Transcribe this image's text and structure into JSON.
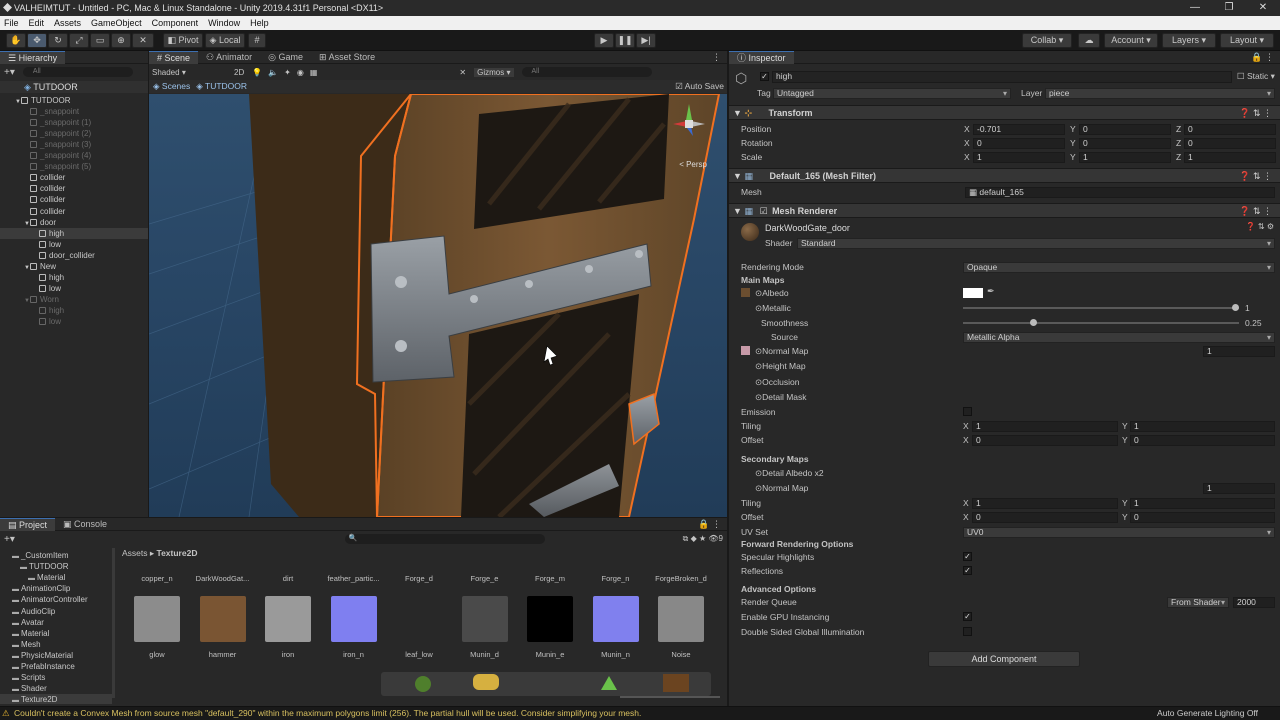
{
  "window": {
    "title": "VALHEIMTUT - Untitled - PC, Mac & Linux Standalone - Unity 2019.4.31f1 Personal <DX11>",
    "controls": [
      "—",
      "❐",
      "✕"
    ]
  },
  "menu": [
    "File",
    "Edit",
    "Assets",
    "GameObject",
    "Component",
    "Window",
    "Help"
  ],
  "toolbar": {
    "pivot": "Pivot",
    "local": "Local",
    "collab": "Collab",
    "account": "Account",
    "layers": "Layers",
    "layout": "Layout"
  },
  "hierarchy": {
    "tab": "Hierarchy",
    "search": "All",
    "scene": "TUTDOOR",
    "items": [
      {
        "label": "TUTDOOR",
        "depth": 1,
        "dim": false,
        "arrow": "▼"
      },
      {
        "label": "_snappoint",
        "depth": 2,
        "dim": true,
        "arrow": ""
      },
      {
        "label": "_snappoint (1)",
        "depth": 2,
        "dim": true,
        "arrow": ""
      },
      {
        "label": "_snappoint (2)",
        "depth": 2,
        "dim": true,
        "arrow": ""
      },
      {
        "label": "_snappoint (3)",
        "depth": 2,
        "dim": true,
        "arrow": ""
      },
      {
        "label": "_snappoint (4)",
        "depth": 2,
        "dim": true,
        "arrow": ""
      },
      {
        "label": "_snappoint (5)",
        "depth": 2,
        "dim": true,
        "arrow": ""
      },
      {
        "label": "collider",
        "depth": 2,
        "dim": false,
        "arrow": ""
      },
      {
        "label": "collider",
        "depth": 2,
        "dim": false,
        "arrow": ""
      },
      {
        "label": "collider",
        "depth": 2,
        "dim": false,
        "arrow": ""
      },
      {
        "label": "collider",
        "depth": 2,
        "dim": false,
        "arrow": ""
      },
      {
        "label": "door",
        "depth": 2,
        "dim": false,
        "arrow": "▼"
      },
      {
        "label": "high",
        "depth": 3,
        "dim": false,
        "arrow": "",
        "selected": true
      },
      {
        "label": "low",
        "depth": 3,
        "dim": false,
        "arrow": ""
      },
      {
        "label": "door_collider",
        "depth": 3,
        "dim": false,
        "arrow": ""
      },
      {
        "label": "New",
        "depth": 2,
        "dim": false,
        "arrow": "▼"
      },
      {
        "label": "high",
        "depth": 3,
        "dim": false,
        "arrow": ""
      },
      {
        "label": "low",
        "depth": 3,
        "dim": false,
        "arrow": ""
      },
      {
        "label": "Worn",
        "depth": 2,
        "dim": true,
        "arrow": "▼"
      },
      {
        "label": "high",
        "depth": 3,
        "dim": true,
        "arrow": ""
      },
      {
        "label": "low",
        "depth": 3,
        "dim": true,
        "arrow": ""
      }
    ]
  },
  "scene": {
    "tabs": [
      "Scene",
      "Animator",
      "Game",
      "Asset Store"
    ],
    "shading": "Shaded",
    "mode2d": "2D",
    "gizmos": "Gizmos",
    "search": "All",
    "breadcrumb": [
      "Scenes",
      "TUTDOOR"
    ],
    "autosave": "Auto Save",
    "persp": "< Persp"
  },
  "inspector": {
    "tab": "Inspector",
    "object_name": "high",
    "static": "Static",
    "tag_label": "Tag",
    "tag": "Untagged",
    "layer_label": "Layer",
    "layer": "piece",
    "transform": {
      "title": "Transform",
      "position_label": "Position",
      "position": [
        "-0.701",
        "0",
        "0"
      ],
      "rotation_label": "Rotation",
      "rotation": [
        "0",
        "0",
        "0"
      ],
      "scale_label": "Scale",
      "scale": [
        "1",
        "1",
        "1"
      ]
    },
    "mesh_filter": {
      "title": "Default_165 (Mesh Filter)",
      "mesh_label": "Mesh",
      "mesh": "default_165"
    },
    "mesh_renderer": {
      "title": "Mesh Renderer"
    },
    "material": {
      "name": "DarkWoodGate_door",
      "shader_label": "Shader",
      "shader": "Standard",
      "rendering_mode_label": "Rendering Mode",
      "rendering_mode": "Opaque",
      "main_maps": "Main Maps",
      "albedo": "Albedo",
      "metallic": "Metallic",
      "metallic_value": 1,
      "metallic_text": "1",
      "smoothness": "Smoothness",
      "smoothness_value": 0.25,
      "smoothness_text": "0.25",
      "source_label": "Source",
      "source": "Metallic Alpha",
      "normal_map": "Normal Map",
      "normal_value": "1",
      "height_map": "Height Map",
      "occlusion": "Occlusion",
      "detail_mask": "Detail Mask",
      "emission": "Emission",
      "tiling_label": "Tiling",
      "tiling": [
        "1",
        "1"
      ],
      "offset_label": "Offset",
      "offset": [
        "0",
        "0"
      ],
      "secondary_maps": "Secondary Maps",
      "detail_albedo": "Detail Albedo x2",
      "normal_map2": "Normal Map",
      "normal_value2": "1",
      "tiling2": [
        "1",
        "1"
      ],
      "offset2": [
        "0",
        "0"
      ],
      "uvset_label": "UV Set",
      "uvset": "UV0",
      "forward_options": "Forward Rendering Options",
      "specular_highlights": "Specular Highlights",
      "reflections": "Reflections",
      "advanced_options": "Advanced Options",
      "render_queue_label": "Render Queue",
      "render_queue_mode": "From Shader",
      "render_queue": "2000",
      "gpu_instancing": "Enable GPU Instancing",
      "double_sided_gi": "Double Sided Global Illumination"
    },
    "add_component": "Add Component"
  },
  "project": {
    "tabs": [
      "Project",
      "Console"
    ],
    "breadcrumb": [
      "Assets",
      "Texture2D"
    ],
    "count": "9",
    "tree": [
      {
        "label": "_CustomItem",
        "depth": 1
      },
      {
        "label": "TUTDOOR",
        "depth": 2
      },
      {
        "label": "Material",
        "depth": 3
      },
      {
        "label": "AnimationClip",
        "depth": 1
      },
      {
        "label": "AnimatorController",
        "depth": 1
      },
      {
        "label": "AudioClip",
        "depth": 1
      },
      {
        "label": "Avatar",
        "depth": 1
      },
      {
        "label": "Material",
        "depth": 1
      },
      {
        "label": "Mesh",
        "depth": 1
      },
      {
        "label": "PhysicMaterial",
        "depth": 1
      },
      {
        "label": "PrefabInstance",
        "depth": 1
      },
      {
        "label": "Scripts",
        "depth": 1
      },
      {
        "label": "Shader",
        "depth": 1
      },
      {
        "label": "Texture2D",
        "depth": 1,
        "selected": true
      }
    ],
    "row1": [
      "copper_n",
      "DarkWoodGat...",
      "dirt",
      "feather_partic...",
      "Forge_d",
      "Forge_e",
      "Forge_m",
      "Forge_n",
      "ForgeBroken_d"
    ],
    "row2": [
      {
        "name": "glow",
        "color": "#8c8c8c"
      },
      {
        "name": "hammer",
        "color": "#7a5533"
      },
      {
        "name": "iron",
        "color": "#9a9a9a"
      },
      {
        "name": "iron_n",
        "color": "#7f7ff0"
      },
      {
        "name": "leaf_low",
        "color": "#282828"
      },
      {
        "name": "Munin_d",
        "color": "#4a4a4a"
      },
      {
        "name": "Munin_e",
        "color": "#000000"
      },
      {
        "name": "Munin_n",
        "color": "#8080ee"
      },
      {
        "name": "Noise",
        "color": "#888888"
      }
    ]
  },
  "status": {
    "message": "Couldn't create a Convex Mesh from source mesh \"default_290\" within the maximum polygons limit (256). The partial hull will be used. Consider simplifying your mesh.",
    "right": "Auto Generate Lighting Off"
  },
  "colors": {
    "accent": "#3d6fb0",
    "selection_outline": "#f07020",
    "panel": "#282828",
    "warning": "#d8c060"
  }
}
